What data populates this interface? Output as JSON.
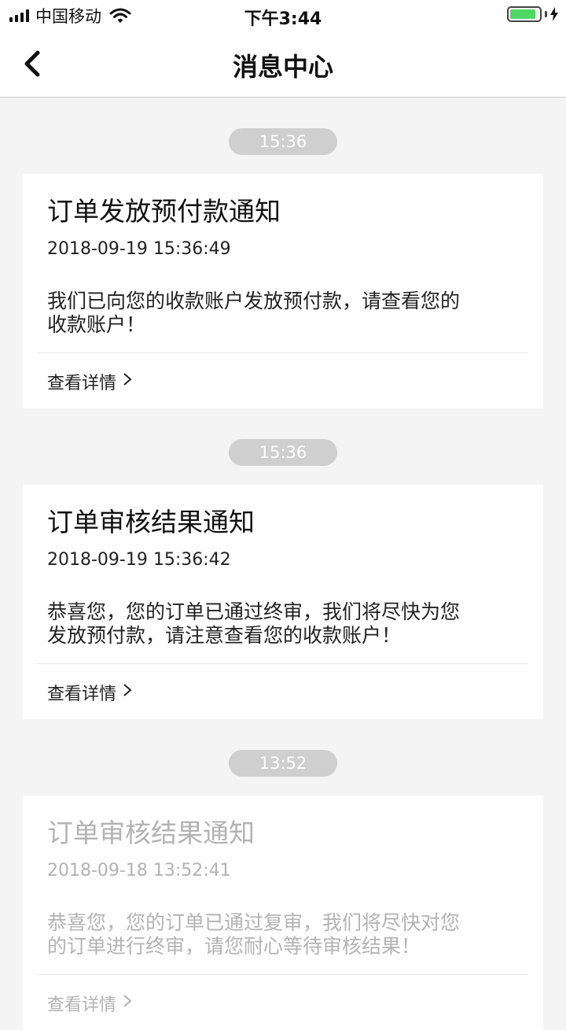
{
  "status_bar": {
    "carrier": "中国移动",
    "time": "下午3:44"
  },
  "nav": {
    "title": "消息中心"
  },
  "messages": [
    {
      "time_group": "15:36",
      "title": "订单发放预付款通知",
      "datetime": "2018-09-19 15:36:49",
      "body_line1": "我们已向您的收款账户发放预付款，请查看您的",
      "body_line2": "收款账户！",
      "link": "查看详情"
    },
    {
      "time_group": "15:36",
      "title": "订单审核结果通知",
      "datetime": "2018-09-19 15:36:42",
      "body_line1": "恭喜您，您的订单已通过终审，我们将尽快为您",
      "body_line2": "发放预付款，请注意查看您的收款账户！",
      "link": "查看详情"
    },
    {
      "time_group": "13:52",
      "title": "订单审核结果通知",
      "datetime": "2018-09-18 13:52:41",
      "body_line1": "恭喜您，您的订单已通过复审，我们将尽快对您",
      "body_line2": "的订单进行终审，请您耐心等待审核结果！",
      "link": "查看详情",
      "read": true
    }
  ],
  "colors": {
    "background": "#f4f4f4",
    "pill": "#cfcfcf",
    "battery": "#4cd964",
    "read_text": "#b3b3b3"
  }
}
